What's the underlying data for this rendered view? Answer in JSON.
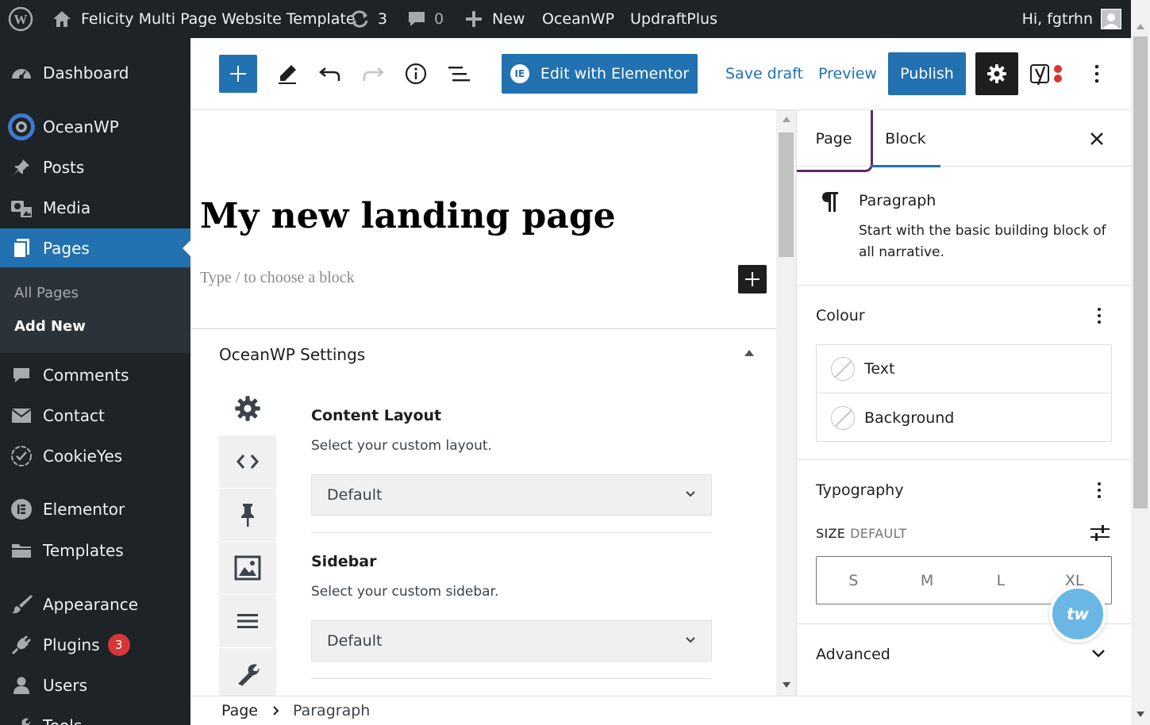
{
  "adminbar": {
    "site_name": "Felicity Multi Page Website Template",
    "updates_count": "3",
    "comments_count": "0",
    "new_label": "New",
    "oceanwp_label": "OceanWP",
    "updraft_label": "UpdraftPlus",
    "greeting": "Hi, fgtrhn"
  },
  "menu": {
    "dashboard": "Dashboard",
    "oceanwp": "OceanWP",
    "posts": "Posts",
    "media": "Media",
    "pages": "Pages",
    "all_pages": "All Pages",
    "add_new": "Add New",
    "comments": "Comments",
    "contact": "Contact",
    "cookieyes": "CookieYes",
    "elementor": "Elementor",
    "templates": "Templates",
    "appearance": "Appearance",
    "plugins": "Plugins",
    "plugins_badge": "3",
    "users": "Users",
    "tools": "Tools"
  },
  "toolbar": {
    "elementor_label": "Edit with Elementor",
    "save_draft": "Save draft",
    "preview": "Preview",
    "publish": "Publish"
  },
  "editor": {
    "title": "My new landing page",
    "placeholder": "Type / to choose a block"
  },
  "oceanwp_settings": {
    "title": "OceanWP Settings",
    "content_layout_label": "Content Layout",
    "content_layout_desc": "Select your custom layout.",
    "content_layout_value": "Default",
    "sidebar_label": "Sidebar",
    "sidebar_desc": "Select your custom sidebar.",
    "sidebar_value": "Default"
  },
  "sidebar": {
    "tab_page": "Page",
    "tab_block": "Block",
    "block_name": "Paragraph",
    "block_desc": "Start with the basic building block of all narrative.",
    "colour_title": "Colour",
    "color_text": "Text",
    "color_background": "Background",
    "typography_title": "Typography",
    "size_label": "SIZE",
    "size_value": "DEFAULT",
    "sizes": [
      "S",
      "M",
      "L",
      "XL"
    ],
    "advanced_title": "Advanced"
  },
  "breadcrumb": {
    "root": "Page",
    "current": "Paragraph"
  },
  "colors": {
    "admin_dark": "#1d2327",
    "accent": "#2271b1",
    "highlight_ring": "#5b2a63",
    "badge_red": "#d63638"
  }
}
